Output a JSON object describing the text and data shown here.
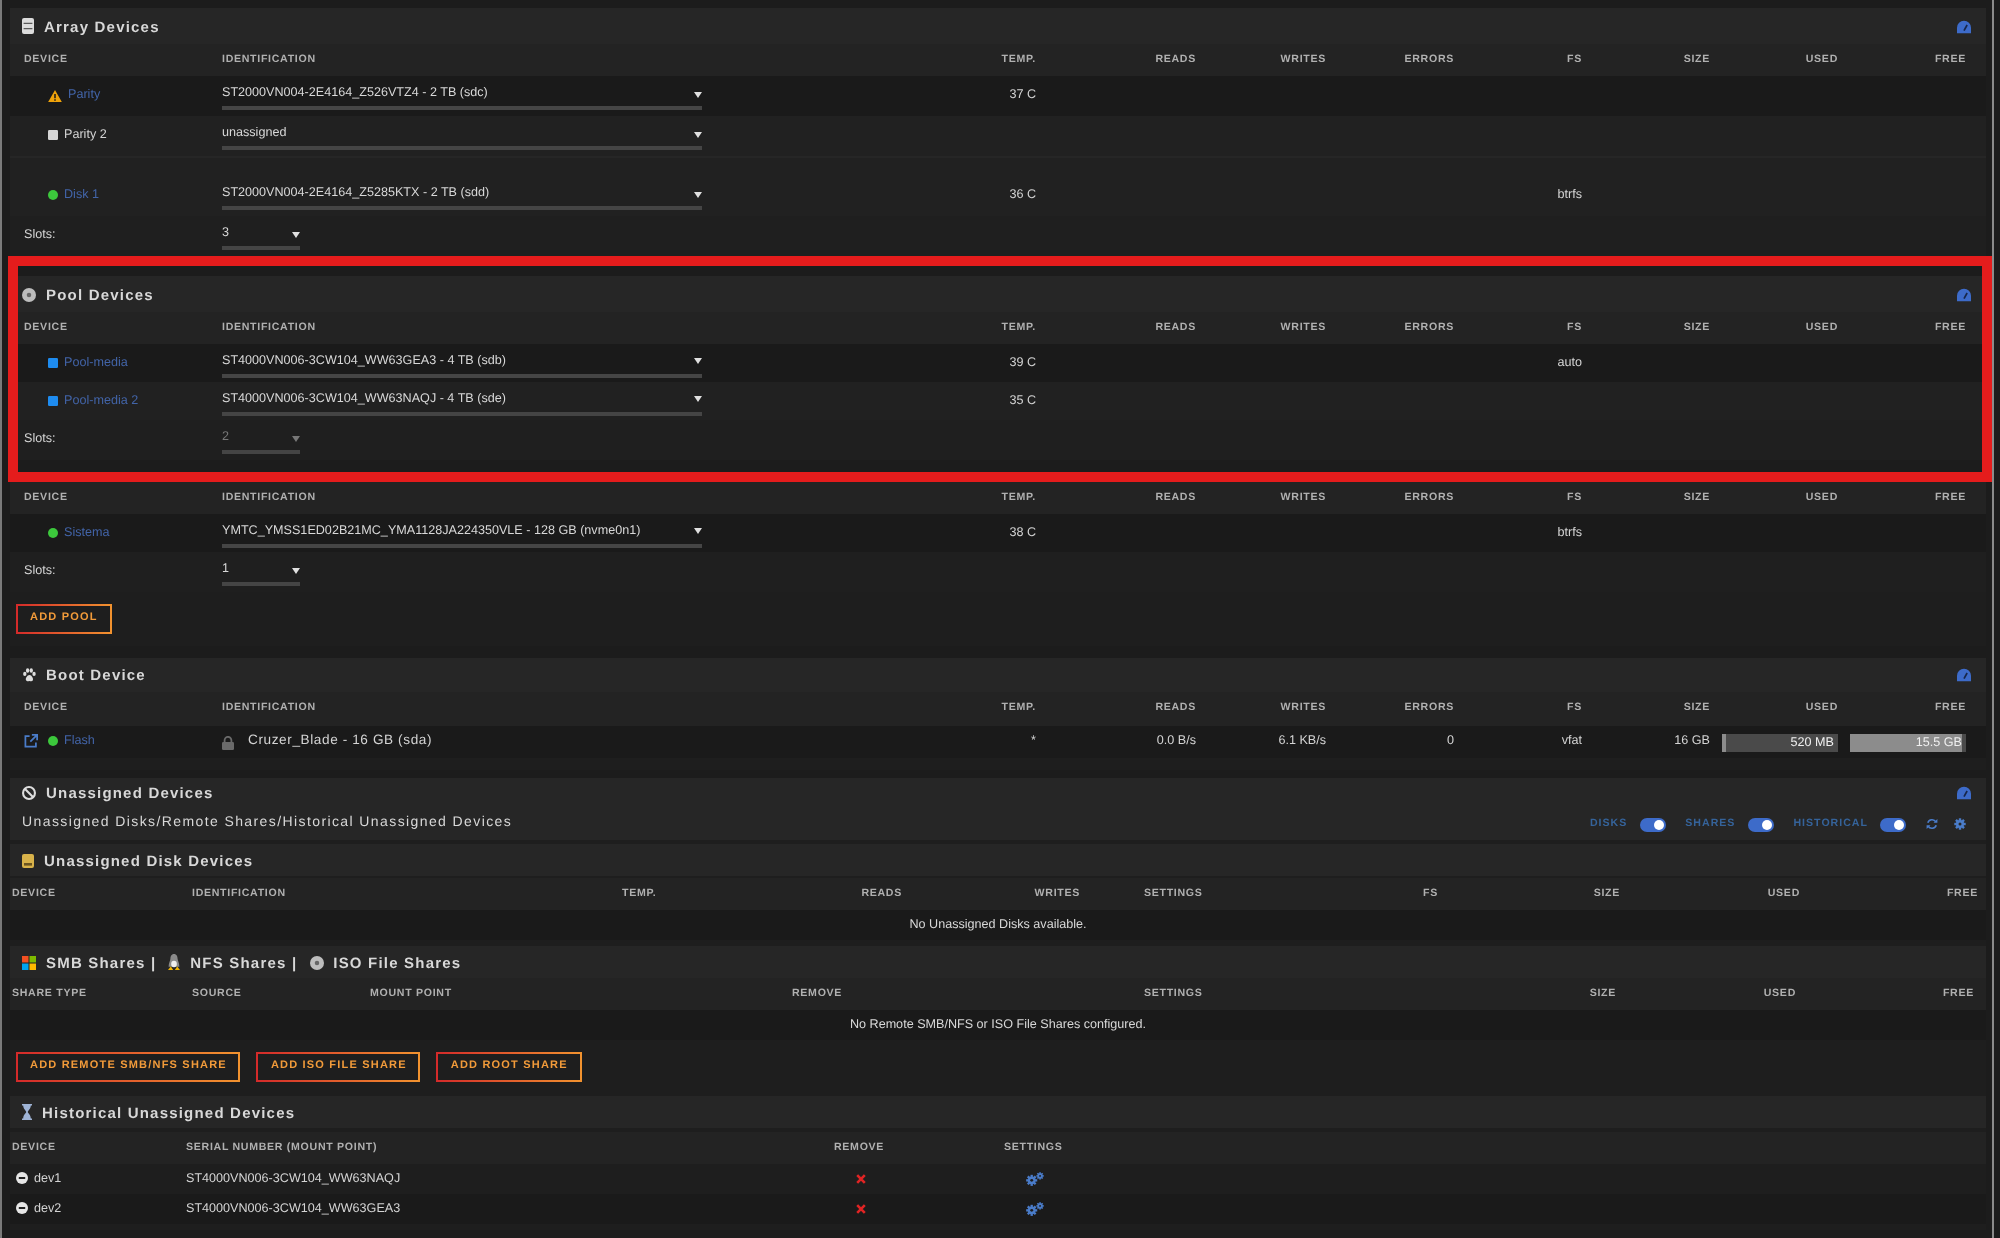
{
  "array_devices": {
    "title": "Array Devices",
    "columns": [
      "DEVICE",
      "IDENTIFICATION",
      "TEMP.",
      "READS",
      "WRITES",
      "ERRORS",
      "FS",
      "SIZE",
      "USED",
      "FREE"
    ],
    "rows": [
      {
        "kind": "device",
        "status": {
          "kind": "triangle",
          "color": "#f0a30a"
        },
        "name": "Parity",
        "link": true,
        "identification": "ST2000VN004-2E4164_Z526VTZ4 - 2 TB (sdc)",
        "temp": "37 C"
      },
      {
        "kind": "device",
        "status": {
          "kind": "square",
          "color": "#d6d6d6"
        },
        "name": "Parity 2",
        "link": false,
        "identification": "unassigned"
      },
      {
        "kind": "separator"
      },
      {
        "kind": "device",
        "status": {
          "kind": "dot",
          "color": "#3cc83c"
        },
        "name": "Disk 1",
        "link": true,
        "identification": "ST2000VN004-2E4164_Z5285KTX - 2 TB (sdd)",
        "temp": "36 C",
        "fs": "btrfs"
      }
    ],
    "slots": {
      "label": "Slots:",
      "value": "3",
      "disabled": false
    }
  },
  "pools": [
    {
      "title": "Pool Devices",
      "highlighted": true,
      "columns": [
        "DEVICE",
        "IDENTIFICATION",
        "TEMP.",
        "READS",
        "WRITES",
        "ERRORS",
        "FS",
        "SIZE",
        "USED",
        "FREE"
      ],
      "rows": [
        {
          "kind": "device",
          "status": {
            "kind": "square",
            "color": "#1e8cf0"
          },
          "name": "Pool-media",
          "link": true,
          "identification": "ST4000VN006-3CW104_WW63GEA3 - 4 TB (sdb)",
          "temp": "39 C",
          "fs": "auto"
        },
        {
          "kind": "device",
          "status": {
            "kind": "square",
            "color": "#1e8cf0"
          },
          "name": "Pool-media 2",
          "link": true,
          "identification": "ST4000VN006-3CW104_WW63NAQJ - 4 TB (sde)",
          "temp": "35 C"
        }
      ],
      "slots": {
        "label": "Slots:",
        "value": "2",
        "disabled": true
      }
    },
    {
      "highlighted": false,
      "columns": [
        "DEVICE",
        "IDENTIFICATION",
        "TEMP.",
        "READS",
        "WRITES",
        "ERRORS",
        "FS",
        "SIZE",
        "USED",
        "FREE"
      ],
      "rows": [
        {
          "kind": "device",
          "status": {
            "kind": "dot",
            "color": "#3cc83c"
          },
          "name": "Sistema",
          "link": true,
          "identification": "YMTC_YMSS1ED02B21MC_YMA1128JA224350VLE - 128 GB (nvme0n1)",
          "temp": "38 C",
          "fs": "btrfs"
        }
      ],
      "slots": {
        "label": "Slots:",
        "value": "1",
        "disabled": false
      }
    }
  ],
  "add_pool_button": "ADD POOL",
  "boot_device": {
    "title": "Boot Device",
    "columns": [
      "DEVICE",
      "IDENTIFICATION",
      "TEMP.",
      "READS",
      "WRITES",
      "ERRORS",
      "FS",
      "SIZE",
      "USED",
      "FREE"
    ],
    "rows": [
      {
        "kind": "boot_device",
        "external_link": true,
        "status": {
          "kind": "dot",
          "color": "#3cc83c"
        },
        "name": "Flash",
        "link": true,
        "identification": "Cruzer_Blade - 16 GB (sda)",
        "temp": "*",
        "reads": "0.0 B/s",
        "writes": "6.1 KB/s",
        "errors": "0",
        "fs": "vfat",
        "size": "16 GB",
        "used": {
          "text": "520 MB",
          "level": 0.03
        },
        "free": {
          "text": "15.5 GB",
          "level": 0.97
        }
      }
    ]
  },
  "unassigned_devices": {
    "title": "Unassigned Devices",
    "subtitle": "Unassigned Disks/Remote Shares/Historical Unassigned Devices",
    "toggles": [
      {
        "label": "DISKS",
        "on": true
      },
      {
        "label": "SHARES",
        "on": true
      },
      {
        "label": "HISTORICAL",
        "on": true
      }
    ],
    "disk_devices": {
      "title": "Unassigned Disk Devices",
      "columns": [
        "DEVICE",
        "IDENTIFICATION",
        "TEMP.",
        "READS",
        "WRITES",
        "SETTINGS",
        "FS",
        "SIZE",
        "USED",
        "FREE"
      ],
      "message": "No Unassigned Disks available."
    },
    "shares": {
      "title_parts": [
        "SMB Shares |",
        "NFS Shares |",
        "ISO File Shares"
      ],
      "columns": [
        "SHARE TYPE",
        "SOURCE",
        "MOUNT POINT",
        "REMOVE",
        "SETTINGS",
        "SIZE",
        "USED",
        "FREE"
      ],
      "message": "No Remote SMB/NFS or ISO File Shares configured.",
      "buttons": [
        "ADD REMOTE SMB/NFS SHARE",
        "ADD ISO FILE SHARE",
        "ADD ROOT SHARE"
      ]
    },
    "historical": {
      "title": "Historical Unassigned Devices",
      "columns": [
        "DEVICE",
        "SERIAL NUMBER (MOUNT POINT)",
        "REMOVE",
        "SETTINGS"
      ],
      "rows": [
        {
          "device": "dev1",
          "serial": "ST4000VN006-3CW104_WW63NAQJ"
        },
        {
          "device": "dev2",
          "serial": "ST4000VN006-3CW104_WW63GEA3"
        }
      ]
    }
  }
}
